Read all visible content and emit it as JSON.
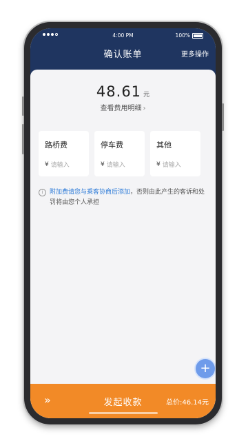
{
  "status": {
    "time": "4:00 PM",
    "battery": "100%"
  },
  "nav": {
    "title": "确认账单",
    "more_label": "更多操作"
  },
  "amount": {
    "value": "48.61",
    "unit": "元",
    "detail_link": "查看费用明细",
    "chevron": "›"
  },
  "fees": [
    {
      "label": "路桥费",
      "currency": "¥",
      "placeholder": "请输入"
    },
    {
      "label": "停车费",
      "currency": "¥",
      "placeholder": "请输入"
    },
    {
      "label": "其他",
      "currency": "¥",
      "placeholder": "请输入"
    }
  ],
  "notice": {
    "icon": "info-icon",
    "icon_glyph": "i",
    "link_text": "附加费请您与乘客协商后添加",
    "text": "，否则由此产生的客诉和处罚将由您个人承担"
  },
  "fab": {
    "icon": "add-icon",
    "glyph": "+"
  },
  "footer": {
    "arrows": "»",
    "action_label": "发起收款",
    "total_text": "总价:46.14元"
  },
  "colors": {
    "header": "#1f3560",
    "footer": "#f28a27",
    "link": "#2f7cd8",
    "fab": "#6e9bea"
  }
}
